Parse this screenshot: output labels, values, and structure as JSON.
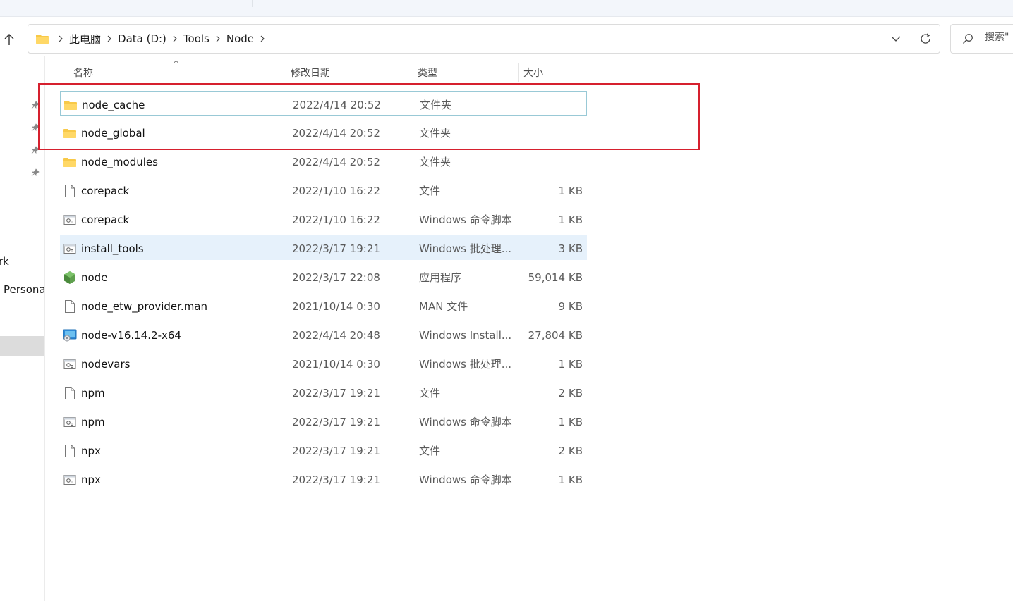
{
  "address_bar": {
    "breadcrumbs": [
      "此电脑",
      "Data (D:)",
      "Tools",
      "Node"
    ]
  },
  "search": {
    "placeholder": "搜索\""
  },
  "nav_pane": {
    "items": [
      "rk",
      "Persona"
    ]
  },
  "columns": {
    "name": "名称",
    "modified": "修改日期",
    "type": "类型",
    "size": "大小"
  },
  "files": [
    {
      "name": "node_cache",
      "modified": "2022/4/14 20:52",
      "type": "文件夹",
      "size": "",
      "icon": "folder-icon"
    },
    {
      "name": "node_global",
      "modified": "2022/4/14 20:52",
      "type": "文件夹",
      "size": "",
      "icon": "folder-icon"
    },
    {
      "name": "node_modules",
      "modified": "2022/4/14 20:52",
      "type": "文件夹",
      "size": "",
      "icon": "folder-icon"
    },
    {
      "name": "corepack",
      "modified": "2022/1/10 16:22",
      "type": "文件",
      "size": "1 KB",
      "icon": "file-icon"
    },
    {
      "name": "corepack",
      "modified": "2022/1/10 16:22",
      "type": "Windows 命令脚本",
      "size": "1 KB",
      "icon": "script-icon"
    },
    {
      "name": "install_tools",
      "modified": "2022/3/17 19:21",
      "type": "Windows 批处理...",
      "size": "3 KB",
      "icon": "script-icon"
    },
    {
      "name": "node",
      "modified": "2022/3/17 22:08",
      "type": "应用程序",
      "size": "59,014 KB",
      "icon": "nodejs-app-icon"
    },
    {
      "name": "node_etw_provider.man",
      "modified": "2021/10/14 0:30",
      "type": "MAN 文件",
      "size": "9 KB",
      "icon": "file-icon"
    },
    {
      "name": "node-v16.14.2-x64",
      "modified": "2022/4/14 20:48",
      "type": "Windows Install...",
      "size": "27,804 KB",
      "icon": "installer-icon"
    },
    {
      "name": "nodevars",
      "modified": "2021/10/14 0:30",
      "type": "Windows 批处理...",
      "size": "1 KB",
      "icon": "script-icon"
    },
    {
      "name": "npm",
      "modified": "2022/3/17 19:21",
      "type": "文件",
      "size": "2 KB",
      "icon": "file-icon"
    },
    {
      "name": "npm",
      "modified": "2022/3/17 19:21",
      "type": "Windows 命令脚本",
      "size": "1 KB",
      "icon": "script-icon"
    },
    {
      "name": "npx",
      "modified": "2022/3/17 19:21",
      "type": "文件",
      "size": "2 KB",
      "icon": "file-icon"
    },
    {
      "name": "npx",
      "modified": "2022/3/17 19:21",
      "type": "Windows 命令脚本",
      "size": "1 KB",
      "icon": "script-icon"
    }
  ],
  "colors": {
    "annotation_box": "#d6202e",
    "folder": "#f8c948",
    "hover_row": "#e6f1fb",
    "focus_border": "#99c9d6"
  }
}
